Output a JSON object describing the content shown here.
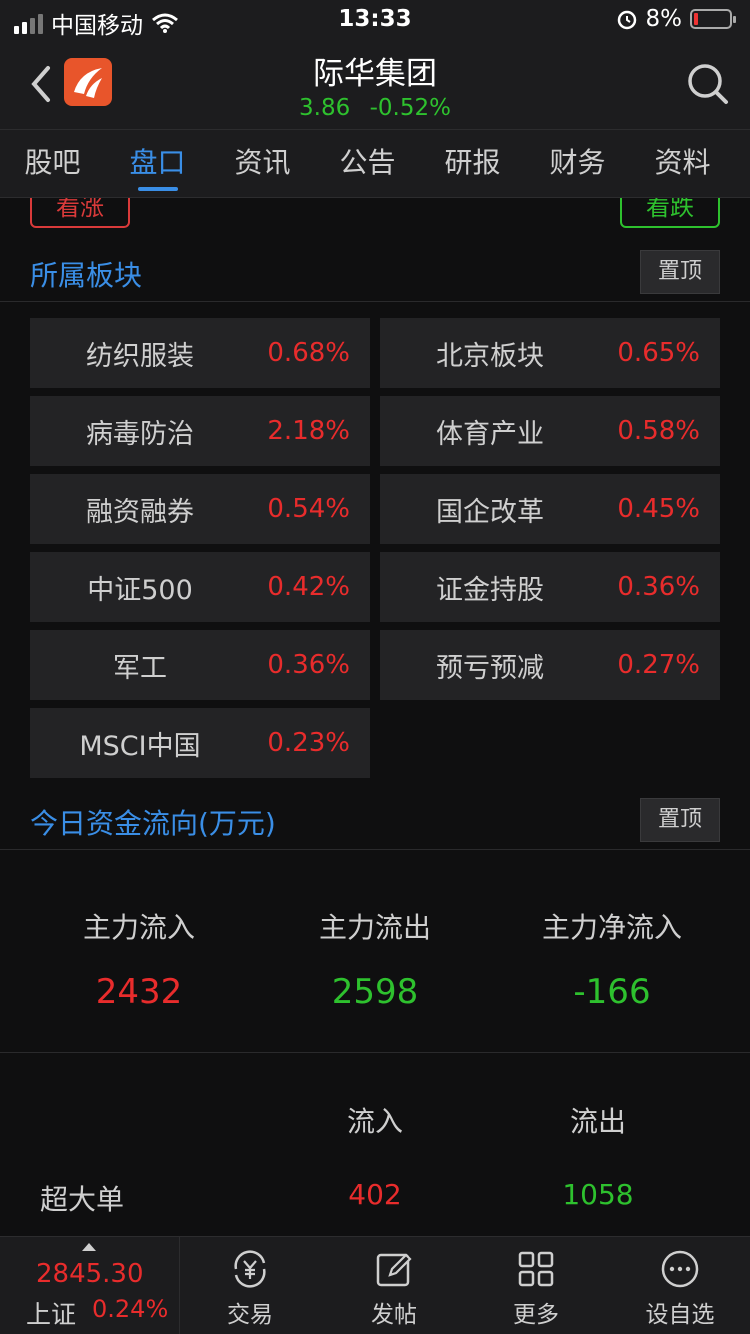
{
  "status_bar": {
    "carrier": "中国移动",
    "time": "13:33",
    "battery": "8%"
  },
  "header": {
    "title": "际华集团",
    "price": "3.86",
    "change": "-0.52%"
  },
  "tabs": [
    "股吧",
    "盘口",
    "资讯",
    "公告",
    "研报",
    "财务",
    "资料"
  ],
  "active_tab": "盘口",
  "vote": {
    "up_label": "看涨",
    "down_label": "看跌"
  },
  "sectors_section": {
    "title": "所属板块",
    "pin_label": "置顶",
    "items": [
      {
        "name": "纺织服装",
        "pct": "0.68%"
      },
      {
        "name": "北京板块",
        "pct": "0.65%"
      },
      {
        "name": "病毒防治",
        "pct": "2.18%"
      },
      {
        "name": "体育产业",
        "pct": "0.58%"
      },
      {
        "name": "融资融券",
        "pct": "0.54%"
      },
      {
        "name": "国企改革",
        "pct": "0.45%"
      },
      {
        "name": "中证500",
        "pct": "0.42%"
      },
      {
        "name": "证金持股",
        "pct": "0.36%"
      },
      {
        "name": "军工",
        "pct": "0.36%"
      },
      {
        "name": "预亏预减",
        "pct": "0.27%"
      },
      {
        "name": "MSCI中国",
        "pct": "0.23%"
      }
    ]
  },
  "fund_flow": {
    "title": "今日资金流向(万元)",
    "pin_label": "置顶",
    "summary": [
      {
        "label": "主力流入",
        "value": "2432",
        "color": "red"
      },
      {
        "label": "主力流出",
        "value": "2598",
        "color": "green"
      },
      {
        "label": "主力净流入",
        "value": "-166",
        "color": "green"
      }
    ],
    "table": {
      "headers": [
        "流入",
        "流出"
      ],
      "rows": [
        {
          "label": "超大单",
          "in": "402",
          "out": "1058"
        }
      ]
    }
  },
  "bottom_bar": {
    "index_value": "2845.30",
    "index_name": "上证",
    "index_pct": "0.24%",
    "nav": [
      {
        "label": "交易",
        "icon": "yuan-cycle-icon"
      },
      {
        "label": "发帖",
        "icon": "edit-post-icon"
      },
      {
        "label": "更多",
        "icon": "grid-more-icon"
      },
      {
        "label": "设自选",
        "icon": "ellipsis-circle-icon"
      }
    ]
  }
}
